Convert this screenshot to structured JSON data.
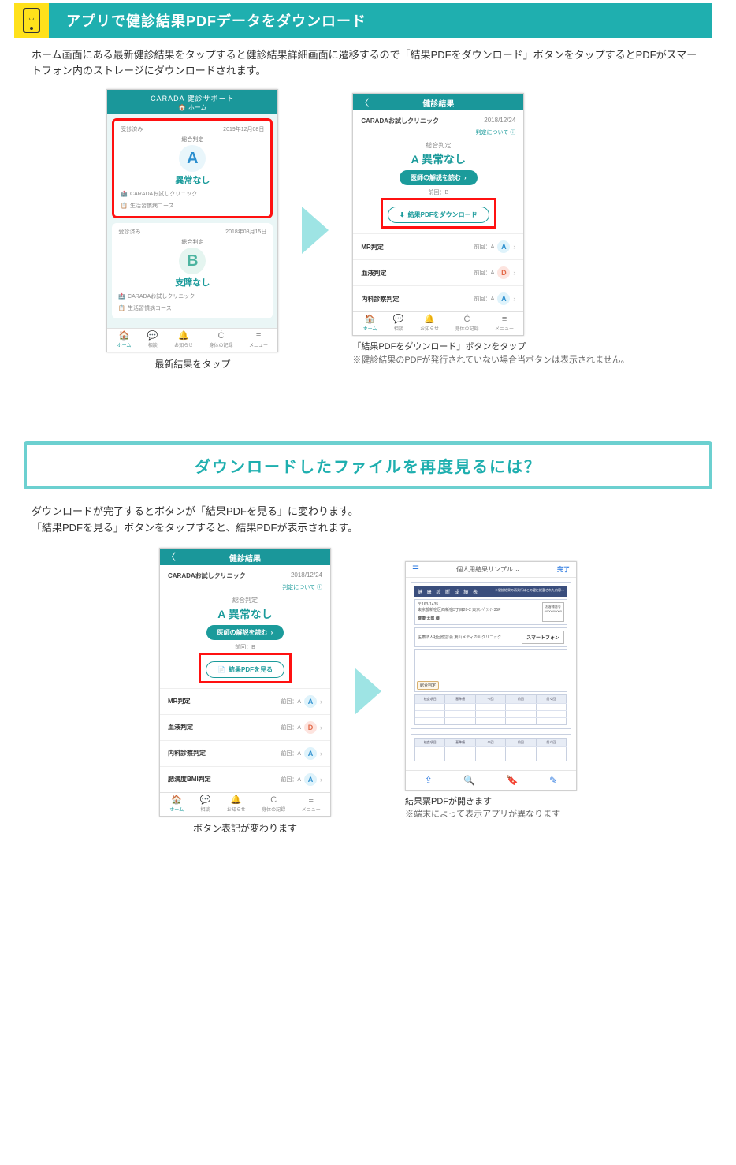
{
  "section1": {
    "title": "アプリで健診結果PDFデータをダウンロード",
    "intro": "ホーム画面にある最新健診結果をタップすると健診結果詳細画面に遷移するので「結果PDFをダウンロード」ボタンをタップするとPDFがスマートフォン内のストレージにダウンロードされます。"
  },
  "phone_home": {
    "brand": "CARADA 健診サポート",
    "sub": "ホーム",
    "card1": {
      "status": "受診済み",
      "date": "2019年12月08日",
      "label": "総合判定",
      "grade": "A",
      "result": "異常なし",
      "clinic": "CARADAお試しクリニック",
      "course": "生活習慣病コース"
    },
    "card2": {
      "status": "受診済み",
      "date": "2018年08月15日",
      "label": "総合判定",
      "grade": "B",
      "result": "支障なし",
      "clinic": "CARADAお試しクリニック",
      "course": "生活習慣病コース"
    }
  },
  "tabbar": {
    "home": "ホーム",
    "consult": "相談",
    "notice": "お知らせ",
    "record": "身体の記録",
    "menu": "メニュー"
  },
  "phone_detail": {
    "header": "健診結果",
    "clinic": "CARADAお試しクリニック",
    "date": "2018/12/24",
    "about_link": "判定について ⓘ",
    "label": "総合判定",
    "grade_line": "A 異常なし",
    "read_btn": "医師の解説を読む",
    "prev": "前回：B",
    "dl_btn": "結果PDFをダウンロード",
    "view_btn": "結果PDFを見る",
    "rows": [
      {
        "name": "MR判定",
        "prev": "前回：A",
        "grade": "A"
      },
      {
        "name": "血液判定",
        "prev": "前回：A",
        "grade": "D"
      },
      {
        "name": "内科診察判定",
        "prev": "前回：A",
        "grade": "A"
      },
      {
        "name": "肥満度BMI判定",
        "prev": "前回：A",
        "grade": "A"
      }
    ]
  },
  "caption1_l": "最新結果をタップ",
  "caption1_r1": "「結果PDFをダウンロード」ボタンをタップ",
  "caption1_r2": "※健診結果のPDFが発行されていない場合当ボタンは表示されません。",
  "callout": "ダウンロードしたファイルを再度見るには？",
  "section2_text": "ダウンロードが完了するとボタンが「結果PDFを見る」に変わります。\n「結果PDFを見る」ボタンをタップすると、結果PDFが表示されます。",
  "caption2_l": "ボタン表記が変わります",
  "caption2_r1": "結果票PDFが開きます",
  "caption2_r2": "※端末によって表示アプリが異なります",
  "pdf": {
    "title": "個人用結果サンプル",
    "done": "完了",
    "doc_title": "健 康 診 断 成 績 表",
    "postal": "〒163-1435",
    "addr": "東京都新宿区西新宿3丁目20-2 東京ｵﾍﾟﾗｼﾃｨ35F",
    "name": "健康 太郎 様",
    "smart": "スマートフォン",
    "clinic_l": "医療法人社団健診会 東山メディカルクリニック",
    "badge": "総合判定"
  }
}
